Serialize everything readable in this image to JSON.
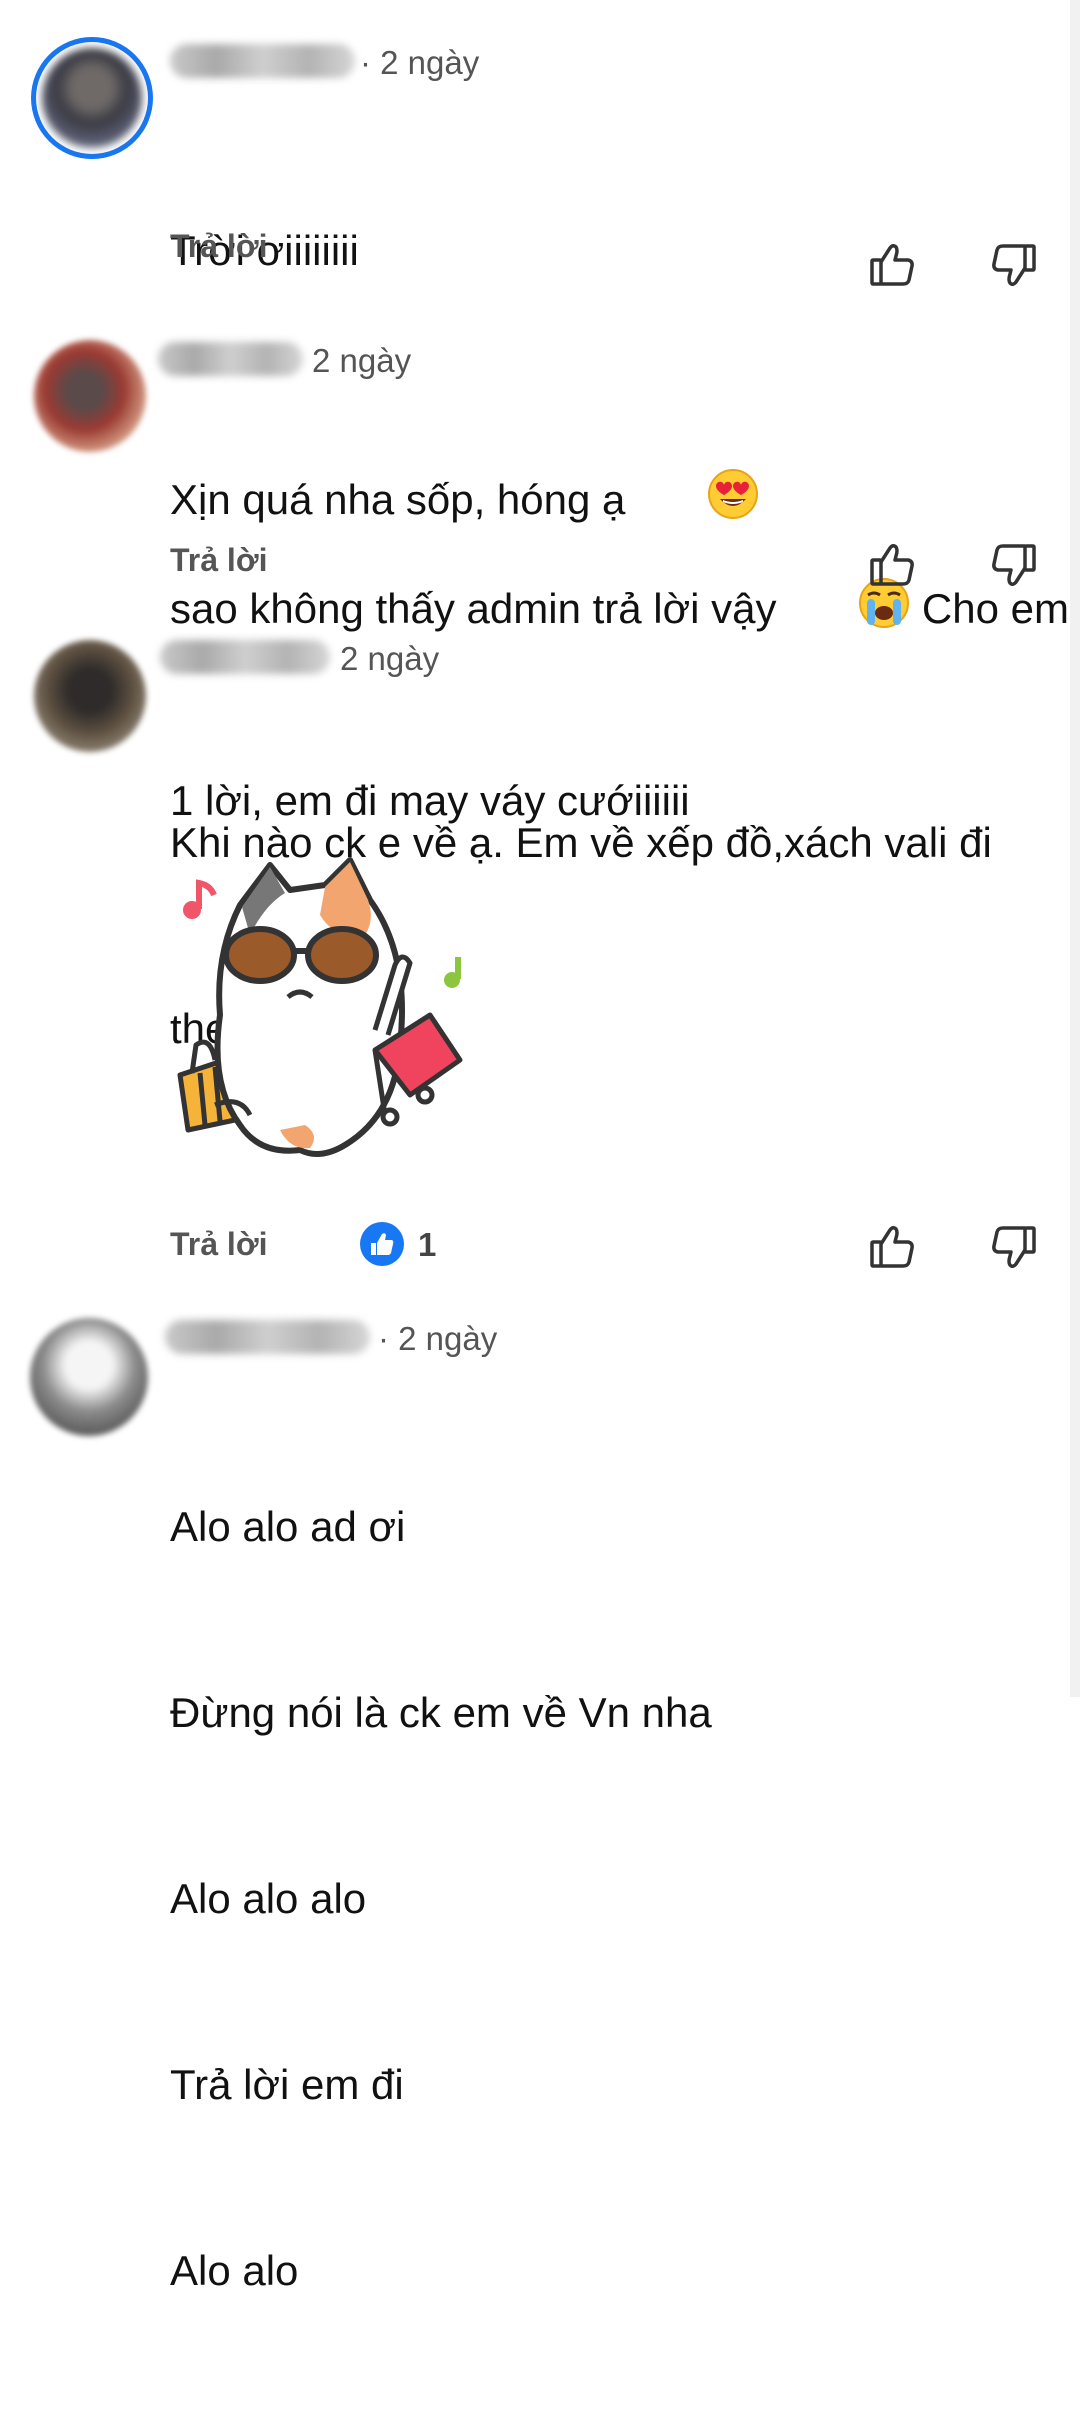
{
  "comments": [
    {
      "time": "· 2 ngày",
      "lines": [
        "Trời ơiiiiiiii",
        "Xịn quá nha sốp, hóng ạ"
      ],
      "emoji": "heart-eyes-emoji",
      "reply_label": "Trả lời"
    },
    {
      "time": "2 ngày",
      "lines": [
        "sao không thấy admin trả lời vậy",
        "Cho em",
        "1 lời, em đi may váy cướiiiiii"
      ],
      "emoji": "crying-emoji",
      "reply_label": "Trả lời"
    },
    {
      "time": "2 ngày",
      "lines": [
        "Khi nào ck e về ạ. Em về xếp đồ,xách vali đi",
        "theo luôn"
      ],
      "sticker": "cat-with-suitcase-sticker",
      "reply_label": "Trả lời",
      "like_count": "1"
    },
    {
      "time": "· 2 ngày",
      "lines": [
        "Alo alo ad ơi",
        "Đừng nói là ck em về Vn nha",
        "Alo alo alo",
        "Trả lời em đi",
        "Alo alo"
      ]
    }
  ],
  "icons": {
    "like": "thumbs-up-icon",
    "dislike": "thumbs-down-icon",
    "reaction": "like-reaction-icon"
  },
  "colors": {
    "accent": "#1877f2",
    "text": "#111111",
    "muted": "#555555"
  }
}
